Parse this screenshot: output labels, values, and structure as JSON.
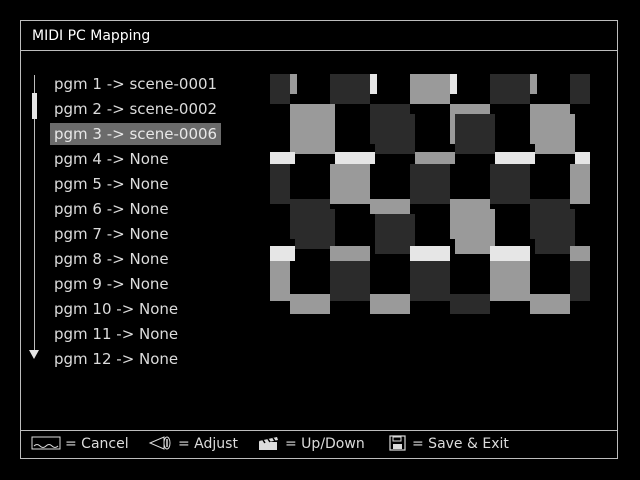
{
  "window": {
    "title": "MIDI PC Mapping"
  },
  "mappings": [
    "pgm 1 -> scene-0001",
    "pgm 2 -> scene-0002",
    "pgm 3 -> scene-0006",
    "pgm 4 -> None",
    "pgm 5 -> None",
    "pgm 6 -> None",
    "pgm 7 -> None",
    "pgm 8 -> None",
    "pgm 9 -> None",
    "pgm 10 -> None",
    "pgm 11 -> None",
    "pgm 12 -> None"
  ],
  "selected_index": 2,
  "preview": {
    "colors": {
      "dark": "#2b2b2b",
      "mid": "#9a9a9a",
      "light": "#e6e6e6",
      "black": "#000000"
    }
  },
  "footer": {
    "cancel": "= Cancel",
    "adjust": "= Adjust",
    "updown": "= Up/Down",
    "save": "= Save & Exit"
  }
}
